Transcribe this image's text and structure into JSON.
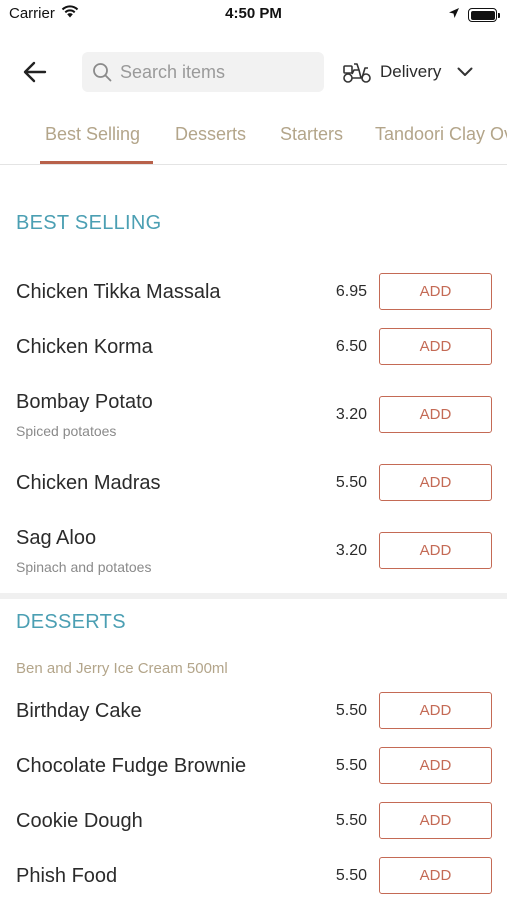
{
  "status_bar": {
    "carrier": "Carrier",
    "time": "4:50 PM"
  },
  "header": {
    "search_placeholder": "Search items",
    "delivery_label": "Delivery"
  },
  "tabs": [
    {
      "label": "Best Selling",
      "active": true
    },
    {
      "label": "Desserts",
      "active": false
    },
    {
      "label": "Starters",
      "active": false
    },
    {
      "label": "Tandoori Clay Oven",
      "active": false
    }
  ],
  "sections": {
    "best_selling": {
      "title": "BEST SELLING",
      "items": [
        {
          "name": "Chicken Tikka Massala",
          "price": "6.95",
          "button": "ADD"
        },
        {
          "name": "Chicken Korma",
          "price": "6.50",
          "button": "ADD"
        },
        {
          "name": "Bombay Potato",
          "description": "Spiced potatoes",
          "price": "3.20",
          "button": "ADD"
        },
        {
          "name": "Chicken Madras",
          "price": "5.50",
          "button": "ADD"
        },
        {
          "name": "Sag Aloo",
          "description": "Spinach and potatoes",
          "price": "3.20",
          "button": "ADD"
        }
      ]
    },
    "desserts": {
      "title": "DESSERTS",
      "subheading": "Ben and Jerry Ice Cream 500ml",
      "items": [
        {
          "name": "Birthday Cake",
          "price": "5.50",
          "button": "ADD"
        },
        {
          "name": "Chocolate Fudge Brownie",
          "price": "5.50",
          "button": "ADD"
        },
        {
          "name": "Cookie Dough",
          "price": "5.50",
          "button": "ADD"
        },
        {
          "name": "Phish Food",
          "price": "5.50",
          "button": "ADD"
        }
      ]
    }
  },
  "colors": {
    "accent": "#c46a55",
    "section_title": "#4b9fb3",
    "tab_text": "#b3a58a"
  }
}
